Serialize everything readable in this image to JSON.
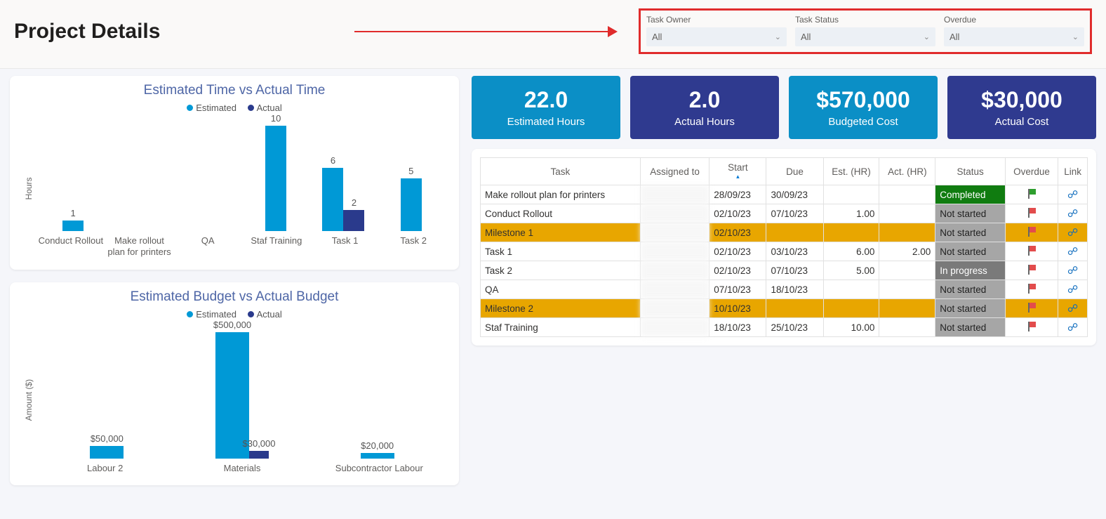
{
  "page_title": "Project Details",
  "filters": {
    "task_owner": {
      "label": "Task Owner",
      "value": "All"
    },
    "task_status": {
      "label": "Task Status",
      "value": "All"
    },
    "overdue": {
      "label": "Overdue",
      "value": "All"
    }
  },
  "legend": {
    "estimated": "Estimated",
    "actual": "Actual"
  },
  "axis": {
    "hours": "Hours",
    "amount": "Amount ($)"
  },
  "chart_data": [
    {
      "type": "bar",
      "title": "Estimated Time vs Actual Time",
      "ylabel": "Hours",
      "ylim": [
        0,
        10
      ],
      "categories": [
        "Conduct Rollout",
        "Make rollout plan for printers",
        "QA",
        "Staf Training",
        "Task 1",
        "Task 2"
      ],
      "series": [
        {
          "name": "Estimated",
          "color": "#0099d6",
          "values": [
            1,
            null,
            null,
            10,
            6,
            5
          ]
        },
        {
          "name": "Actual",
          "color": "#2a3a8c",
          "values": [
            null,
            null,
            null,
            null,
            2,
            null
          ]
        }
      ]
    },
    {
      "type": "bar",
      "title": "Estimated Budget vs Actual Budget",
      "ylabel": "Amount ($)",
      "ylim": [
        0,
        500000
      ],
      "categories": [
        "Labour 2",
        "Materials",
        "Subcontractor Labour"
      ],
      "series": [
        {
          "name": "Estimated",
          "color": "#0099d6",
          "values": [
            50000,
            500000,
            20000
          ],
          "labels": [
            "$50,000",
            "$500,000",
            "$20,000"
          ]
        },
        {
          "name": "Actual",
          "color": "#2a3a8c",
          "values": [
            null,
            30000,
            null
          ],
          "labels": [
            null,
            "$30,000",
            null
          ]
        }
      ]
    }
  ],
  "kpis": [
    {
      "value": "22.0",
      "label": "Estimated Hours",
      "class": "kpi-cyan"
    },
    {
      "value": "2.0",
      "label": "Actual Hours",
      "class": "kpi-dblue"
    },
    {
      "value": "$570,000",
      "label": "Budgeted Cost",
      "class": "kpi-cyan"
    },
    {
      "value": "$30,000",
      "label": "Actual Cost",
      "class": "kpi-dblue"
    }
  ],
  "table": {
    "columns": [
      "Task",
      "Assigned to",
      "Start",
      "Due",
      "Est. (HR)",
      "Act. (HR)",
      "Status",
      "Overdue",
      "Link"
    ],
    "rows": [
      {
        "task": "Make rollout plan for printers",
        "assigned": "",
        "start": "28/09/23",
        "due": "30/09/23",
        "est": "",
        "act": "",
        "status": "Completed",
        "status_class": "st-completed",
        "flag": "green",
        "milestone": false,
        "link": true
      },
      {
        "task": "Conduct Rollout",
        "assigned": "",
        "start": "02/10/23",
        "due": "07/10/23",
        "est": "1.00",
        "act": "",
        "status": "Not started",
        "status_class": "st-notstarted",
        "flag": "red",
        "milestone": false,
        "link": true
      },
      {
        "task": "Milestone 1",
        "assigned": "",
        "start": "02/10/23",
        "due": "",
        "est": "",
        "act": "",
        "status": "Not started",
        "status_class": "st-notstarted",
        "flag": "red",
        "milestone": true,
        "link": true
      },
      {
        "task": "Task 1",
        "assigned": "",
        "start": "02/10/23",
        "due": "03/10/23",
        "est": "6.00",
        "act": "2.00",
        "status": "Not started",
        "status_class": "st-notstarted",
        "flag": "red",
        "milestone": false,
        "link": true
      },
      {
        "task": "Task 2",
        "assigned": "",
        "start": "02/10/23",
        "due": "07/10/23",
        "est": "5.00",
        "act": "",
        "status": "In progress",
        "status_class": "st-inprogress",
        "flag": "red",
        "milestone": false,
        "link": true
      },
      {
        "task": "QA",
        "assigned": "",
        "start": "07/10/23",
        "due": "18/10/23",
        "est": "",
        "act": "",
        "status": "Not started",
        "status_class": "st-notstarted",
        "flag": "red",
        "milestone": false,
        "link": true
      },
      {
        "task": "Milestone 2",
        "assigned": "",
        "start": "10/10/23",
        "due": "",
        "est": "",
        "act": "",
        "status": "Not started",
        "status_class": "st-notstarted",
        "flag": "red",
        "milestone": true,
        "link": true
      },
      {
        "task": "Staf Training",
        "assigned": "",
        "start": "18/10/23",
        "due": "25/10/23",
        "est": "10.00",
        "act": "",
        "status": "Not started",
        "status_class": "st-notstarted",
        "flag": "red",
        "milestone": false,
        "link": true
      }
    ]
  }
}
